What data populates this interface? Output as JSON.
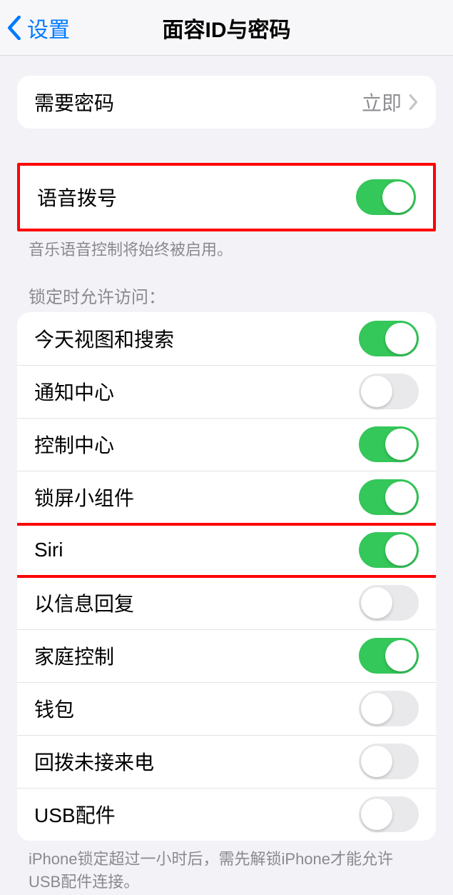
{
  "nav": {
    "back_label": "设置",
    "title": "面容ID与密码"
  },
  "group1": {
    "require_passcode": {
      "label": "需要密码",
      "value": "立即"
    }
  },
  "group2": {
    "voice_dial": {
      "label": "语音拨号",
      "on": true
    },
    "footer": "音乐语音控制将始终被启用。"
  },
  "group3_header": "锁定时允许访问：",
  "group3": {
    "today": {
      "label": "今天视图和搜索",
      "on": true
    },
    "notification_center": {
      "label": "通知中心",
      "on": false
    },
    "control_center": {
      "label": "控制中心",
      "on": true
    },
    "lock_widgets": {
      "label": "锁屏小组件",
      "on": true
    },
    "siri": {
      "label": "Siri",
      "on": true
    },
    "reply_msg": {
      "label": "以信息回复",
      "on": false
    },
    "home_control": {
      "label": "家庭控制",
      "on": true
    },
    "wallet": {
      "label": "钱包",
      "on": false
    },
    "callback": {
      "label": "回拨未接来电",
      "on": false
    },
    "usb": {
      "label": "USB配件",
      "on": false
    }
  },
  "group3_footer": "iPhone锁定超过一小时后，需先解锁iPhone才能允许USB配件连接。"
}
